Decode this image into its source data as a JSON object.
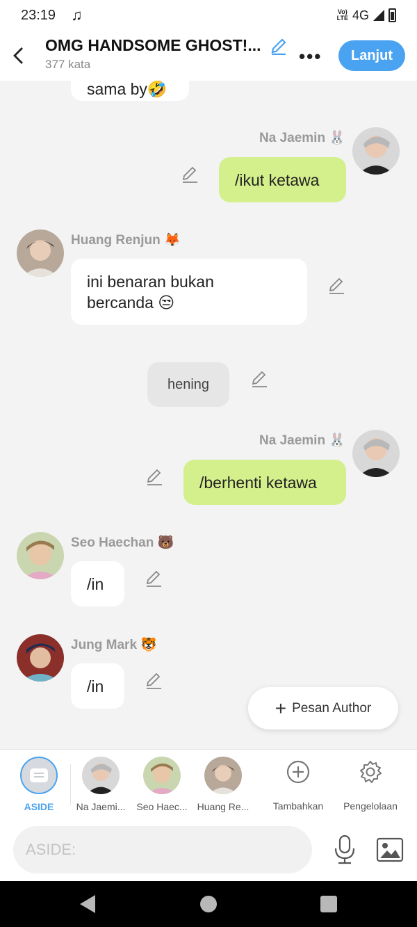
{
  "status_bar": {
    "time": "23:19",
    "network": "4G",
    "volte_top": "Vo)",
    "volte_bottom": "LTE"
  },
  "header": {
    "title": "OMG HANDSOME GHOST!...",
    "word_count": "377 kata",
    "next_label": "Lanjut"
  },
  "chat": {
    "partial_top_text": "sama by🤣",
    "messages": [
      {
        "sender": "Na Jaemin 🐰",
        "text": "/ikut ketawa"
      },
      {
        "sender": "Huang Renjun 🦊",
        "text_line1": "ini benaran bukan",
        "text_line2": "bercanda 😒"
      },
      {
        "text": "hening"
      },
      {
        "sender": "Na Jaemin 🐰",
        "text": "/berhenti ketawa"
      },
      {
        "sender": "Seo Haechan 🐻",
        "text": "/in"
      },
      {
        "sender": "Jung Mark 🐯",
        "text": "/in"
      }
    ]
  },
  "pesan_author": "Pesan Author",
  "characters": [
    {
      "label": "ASIDE"
    },
    {
      "label": "Na Jaemi..."
    },
    {
      "label": "Seo Haec..."
    },
    {
      "label": "Huang Re..."
    }
  ],
  "tools": {
    "add_label": "Tambahkan",
    "manage_label": "Pengelolaan"
  },
  "input": {
    "placeholder": "ASIDE:"
  },
  "colors": {
    "accent": "#4aa3f0",
    "bubble_green": "#d4f08c"
  }
}
